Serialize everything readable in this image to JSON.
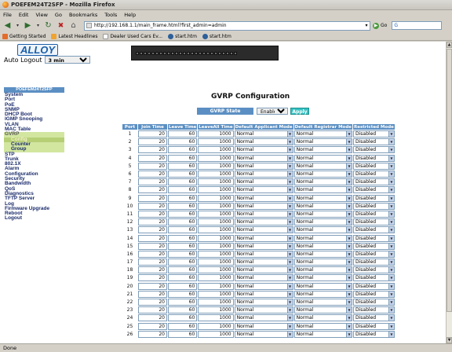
{
  "window": {
    "title": "POEFEM24T2SFP - Mozilla Firefox"
  },
  "menu": [
    "File",
    "Edit",
    "View",
    "Go",
    "Bookmarks",
    "Tools",
    "Help"
  ],
  "url": "http://192.168.1.1/main_frame.html?first_admin=admin",
  "go_label": "Go",
  "bookmarks": [
    "Getting Started",
    "Latest Headlines",
    "Dealer Used Cars Ev...",
    "start.htm",
    "start.htm"
  ],
  "status": "Done",
  "logo": "ALLOY",
  "auto_logout": {
    "label": "Auto Logout",
    "value": "3 min"
  },
  "sidebar": {
    "header": "POEFEM24T2SFP",
    "items": [
      "System",
      "Port",
      "PoE",
      "SNMP",
      "DHCP Boot",
      "IGMP Snooping",
      "VLAN",
      "MAC Table",
      "GVRP",
      "Config",
      "Counter",
      "Group",
      "STP",
      "Trunk",
      "802.1X",
      "Alarm",
      "Configuration",
      "Security",
      "Bandwidth",
      "QoS",
      "Diagnostics",
      "TFTP Server",
      "Log",
      "Firmware Upgrade",
      "Reboot",
      "Logout"
    ]
  },
  "page_title": "GVRP Configuration",
  "gvrp_state": {
    "label": "GVRP State",
    "value": "Enabled",
    "apply": "Apply"
  },
  "table": {
    "headers": [
      "Port",
      "Join Time",
      "Leave Time",
      "LeaveAll Time",
      "Default Applicant Mode",
      "Default Registrar Mode",
      "Restricted Mode"
    ],
    "rows": [
      {
        "port": "1",
        "join": "20",
        "leave": "60",
        "leaveall": "1000",
        "applicant": "Normal",
        "registrar": "Normal",
        "restricted": "Disabled"
      },
      {
        "port": "2",
        "join": "20",
        "leave": "60",
        "leaveall": "1000",
        "applicant": "Normal",
        "registrar": "Normal",
        "restricted": "Disabled"
      },
      {
        "port": "3",
        "join": "20",
        "leave": "60",
        "leaveall": "1000",
        "applicant": "Normal",
        "registrar": "Normal",
        "restricted": "Disabled"
      },
      {
        "port": "4",
        "join": "20",
        "leave": "60",
        "leaveall": "1000",
        "applicant": "Normal",
        "registrar": "Normal",
        "restricted": "Disabled"
      },
      {
        "port": "5",
        "join": "20",
        "leave": "60",
        "leaveall": "1000",
        "applicant": "Normal",
        "registrar": "Normal",
        "restricted": "Disabled"
      },
      {
        "port": "6",
        "join": "20",
        "leave": "60",
        "leaveall": "1000",
        "applicant": "Normal",
        "registrar": "Normal",
        "restricted": "Disabled"
      },
      {
        "port": "7",
        "join": "20",
        "leave": "60",
        "leaveall": "1000",
        "applicant": "Normal",
        "registrar": "Normal",
        "restricted": "Disabled"
      },
      {
        "port": "8",
        "join": "20",
        "leave": "60",
        "leaveall": "1000",
        "applicant": "Normal",
        "registrar": "Normal",
        "restricted": "Disabled"
      },
      {
        "port": "9",
        "join": "20",
        "leave": "60",
        "leaveall": "1000",
        "applicant": "Normal",
        "registrar": "Normal",
        "restricted": "Disabled"
      },
      {
        "port": "10",
        "join": "20",
        "leave": "60",
        "leaveall": "1000",
        "applicant": "Normal",
        "registrar": "Normal",
        "restricted": "Disabled"
      },
      {
        "port": "11",
        "join": "20",
        "leave": "60",
        "leaveall": "1000",
        "applicant": "Normal",
        "registrar": "Normal",
        "restricted": "Disabled"
      },
      {
        "port": "12",
        "join": "20",
        "leave": "60",
        "leaveall": "1000",
        "applicant": "Normal",
        "registrar": "Normal",
        "restricted": "Disabled"
      },
      {
        "port": "13",
        "join": "20",
        "leave": "60",
        "leaveall": "1000",
        "applicant": "Normal",
        "registrar": "Normal",
        "restricted": "Disabled"
      },
      {
        "port": "14",
        "join": "20",
        "leave": "60",
        "leaveall": "1000",
        "applicant": "Normal",
        "registrar": "Normal",
        "restricted": "Disabled"
      },
      {
        "port": "15",
        "join": "20",
        "leave": "60",
        "leaveall": "1000",
        "applicant": "Normal",
        "registrar": "Normal",
        "restricted": "Disabled"
      },
      {
        "port": "16",
        "join": "20",
        "leave": "60",
        "leaveall": "1000",
        "applicant": "Normal",
        "registrar": "Normal",
        "restricted": "Disabled"
      },
      {
        "port": "17",
        "join": "20",
        "leave": "60",
        "leaveall": "1000",
        "applicant": "Normal",
        "registrar": "Normal",
        "restricted": "Disabled"
      },
      {
        "port": "18",
        "join": "20",
        "leave": "60",
        "leaveall": "1000",
        "applicant": "Normal",
        "registrar": "Normal",
        "restricted": "Disabled"
      },
      {
        "port": "19",
        "join": "20",
        "leave": "60",
        "leaveall": "1000",
        "applicant": "Normal",
        "registrar": "Normal",
        "restricted": "Disabled"
      },
      {
        "port": "20",
        "join": "20",
        "leave": "60",
        "leaveall": "1000",
        "applicant": "Normal",
        "registrar": "Normal",
        "restricted": "Disabled"
      },
      {
        "port": "21",
        "join": "20",
        "leave": "60",
        "leaveall": "1000",
        "applicant": "Normal",
        "registrar": "Normal",
        "restricted": "Disabled"
      },
      {
        "port": "22",
        "join": "20",
        "leave": "60",
        "leaveall": "1000",
        "applicant": "Normal",
        "registrar": "Normal",
        "restricted": "Disabled"
      },
      {
        "port": "23",
        "join": "20",
        "leave": "60",
        "leaveall": "1000",
        "applicant": "Normal",
        "registrar": "Normal",
        "restricted": "Disabled"
      },
      {
        "port": "24",
        "join": "20",
        "leave": "60",
        "leaveall": "1000",
        "applicant": "Normal",
        "registrar": "Normal",
        "restricted": "Disabled"
      },
      {
        "port": "25",
        "join": "20",
        "leave": "60",
        "leaveall": "1000",
        "applicant": "Normal",
        "registrar": "Normal",
        "restricted": "Disabled"
      },
      {
        "port": "26",
        "join": "20",
        "leave": "60",
        "leaveall": "1000",
        "applicant": "Normal",
        "registrar": "Normal",
        "restricted": "Disabled"
      }
    ]
  }
}
